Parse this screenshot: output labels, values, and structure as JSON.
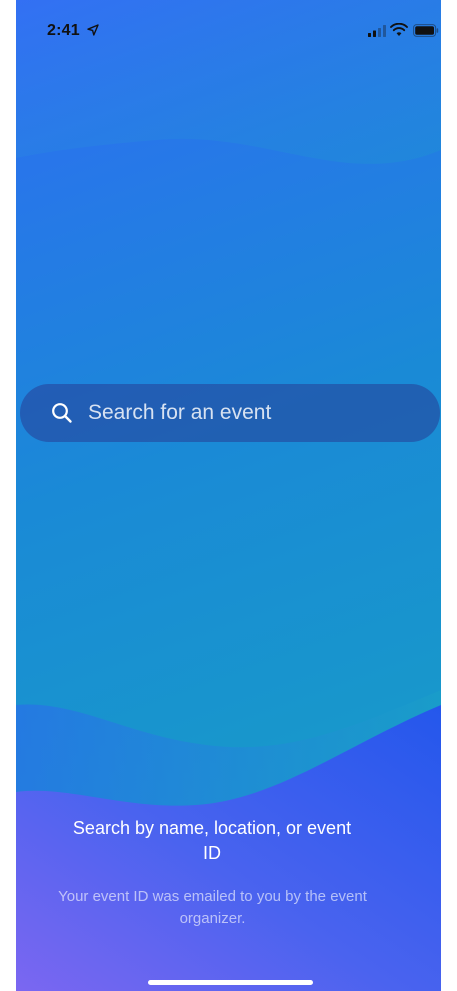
{
  "status_bar": {
    "time": "2:41",
    "icons": [
      "location-arrow-icon",
      "cellular-signal-icon",
      "wifi-icon",
      "battery-icon"
    ]
  },
  "search": {
    "placeholder": "Search for an event",
    "value": "",
    "icon": "search-icon"
  },
  "helper": {
    "title": "Search by name, location, or event ID",
    "subtitle": "Your event ID was emailed to you by the event organizer."
  },
  "colors": {
    "gradient_start": "#2f6cf4",
    "gradient_mid": "#1a8ad6",
    "gradient_end": "#16a3c2",
    "wave_bottom_start": "#7a66f0",
    "wave_bottom_end": "#2f5bee",
    "search_bg": "#263e96",
    "text_primary": "#ffffff"
  }
}
